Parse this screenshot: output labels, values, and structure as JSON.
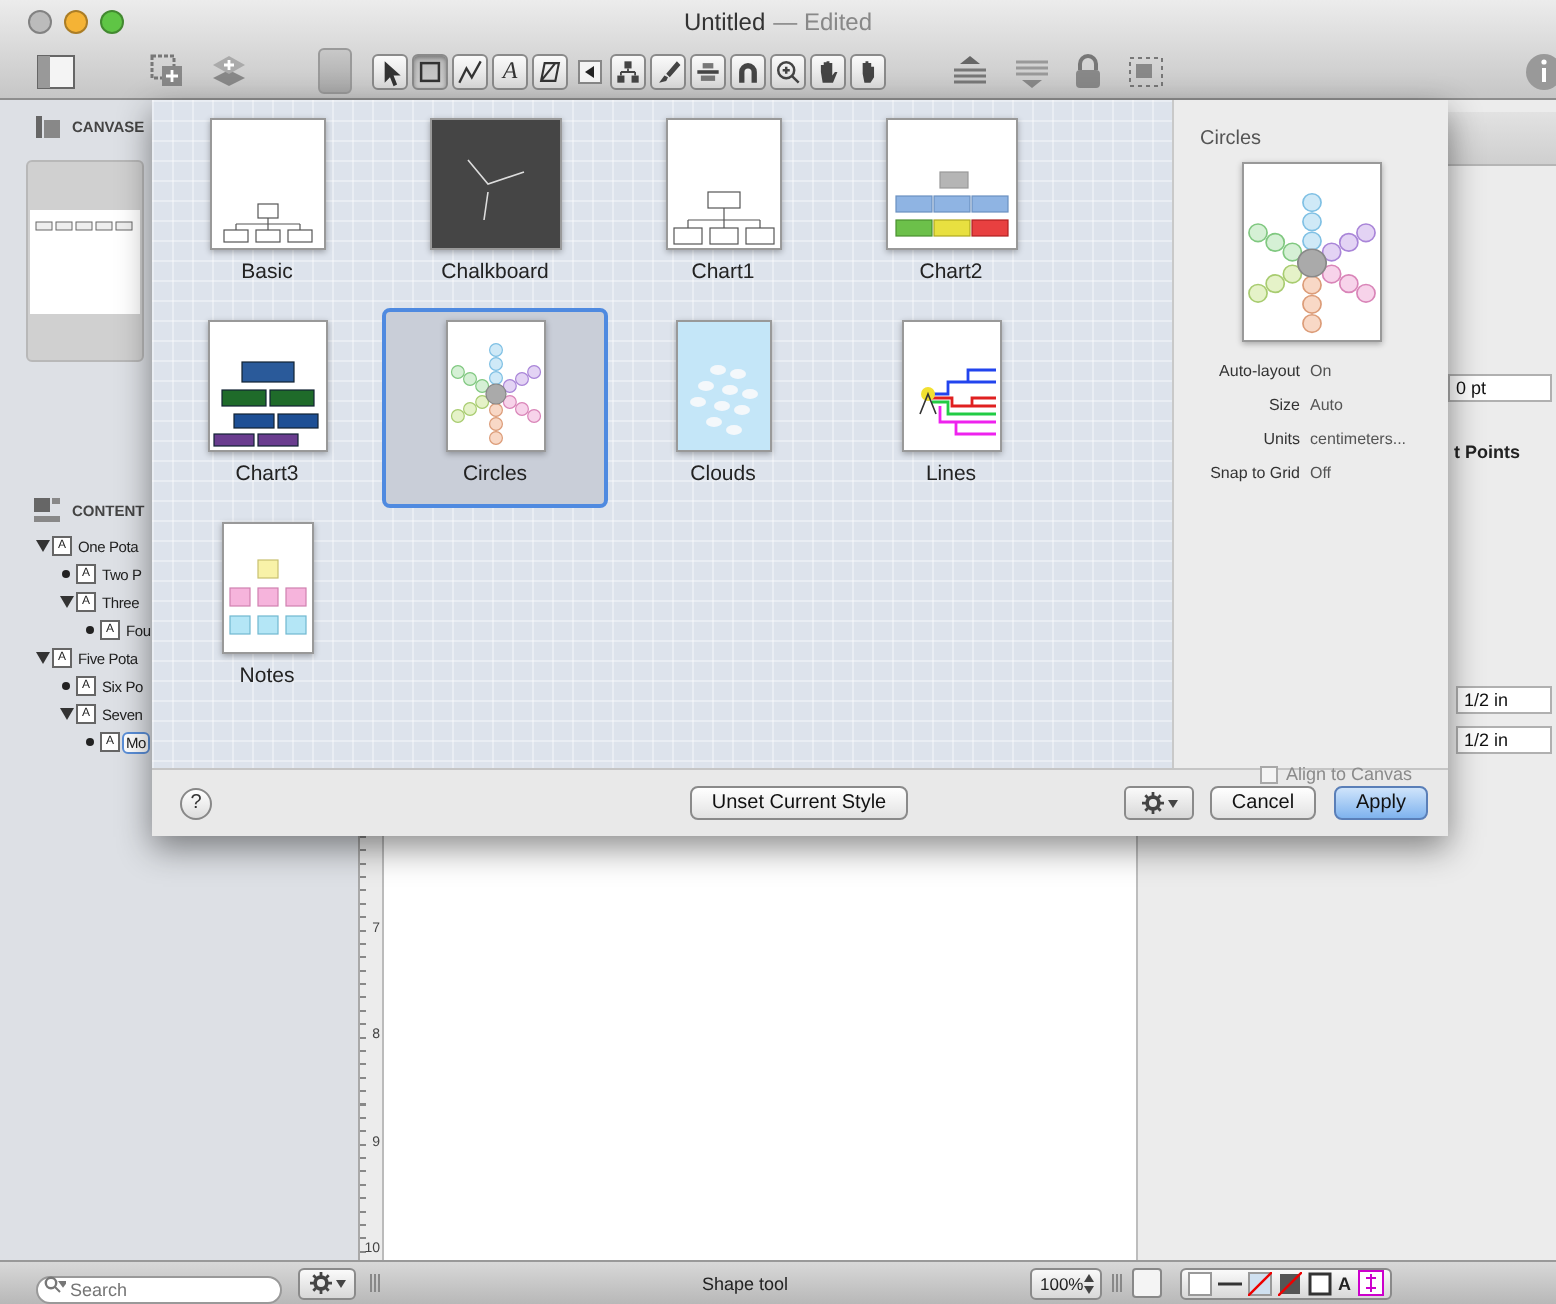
{
  "window": {
    "title": "Untitled",
    "status": "— Edited"
  },
  "toolbar": {
    "tools": [
      {
        "selected": false
      },
      {
        "selected": true
      },
      {
        "selected": false
      },
      {
        "glyph": "A",
        "selected": false
      },
      {
        "selected": false
      }
    ]
  },
  "sidebar": {
    "canvases_header": "CANVASE",
    "contents_header": "CONTENT",
    "outline": [
      {
        "badge": "A",
        "text": "One Pota",
        "selected": false,
        "children": [
          {
            "badge": "A",
            "text": "Two P",
            "selected": false
          },
          {
            "badge": "A",
            "text": "Three",
            "selected": false,
            "children": [
              {
                "badge": "A",
                "text": "Fou",
                "selected": false
              }
            ]
          }
        ]
      },
      {
        "badge": "A",
        "text": "Five Pota",
        "selected": false,
        "children": [
          {
            "badge": "A",
            "text": "Six Po",
            "selected": false
          },
          {
            "badge": "A",
            "text": "Seven",
            "selected": false,
            "children": [
              {
                "badge": "A",
                "text": "Mo",
                "selected": true
              }
            ]
          }
        ]
      }
    ]
  },
  "ruler": {
    "marks": [
      "7",
      "8",
      "9",
      "10"
    ]
  },
  "inspector": {
    "stroke_field": "0 pt",
    "points_label": "t Points",
    "margin_fields": [
      "1/2 in",
      "1/2 in"
    ],
    "align_checkbox": {
      "label": "Align to Canvas",
      "checked": false
    }
  },
  "style_sheet": {
    "templates": [
      {
        "name": "Basic",
        "kind": "basic",
        "selected": false
      },
      {
        "name": "Chalkboard",
        "kind": "chalkboard",
        "selected": false
      },
      {
        "name": "Chart1",
        "kind": "chart1",
        "selected": false
      },
      {
        "name": "Chart2",
        "kind": "chart2",
        "selected": false
      },
      {
        "name": "Chart3",
        "kind": "chart3",
        "selected": false
      },
      {
        "name": "Circles",
        "kind": "circles",
        "selected": true
      },
      {
        "name": "Clouds",
        "kind": "clouds",
        "selected": false
      },
      {
        "name": "Lines",
        "kind": "lines",
        "selected": false
      },
      {
        "name": "Notes",
        "kind": "notes",
        "selected": false
      }
    ],
    "preview": {
      "title": "Circles",
      "kind": "circles",
      "properties": [
        {
          "label": "Auto-layout",
          "value": "On"
        },
        {
          "label": "Size",
          "value": "Auto"
        },
        {
          "label": "Units",
          "value": "centimeters..."
        },
        {
          "label": "Snap to Grid",
          "value": "Off"
        }
      ]
    },
    "help": "?",
    "unset": "Unset Current Style",
    "cancel": "Cancel",
    "apply": "Apply"
  },
  "status_bar": {
    "search_placeholder": "Search",
    "tool": "Shape tool",
    "zoom": "100%",
    "text_style": "A"
  }
}
